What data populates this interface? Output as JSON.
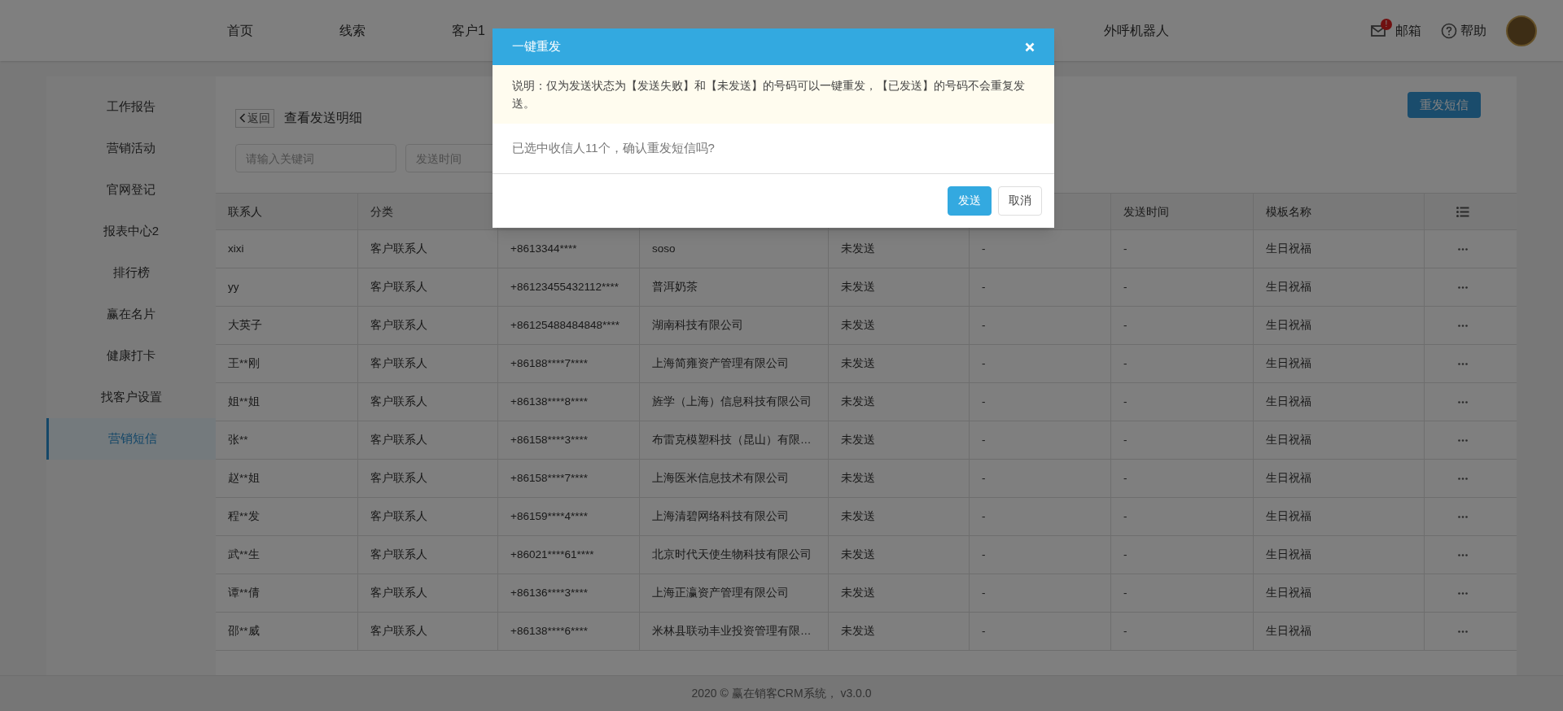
{
  "nav": {
    "items": [
      "首页",
      "线索",
      "客户1",
      "外呼机器人"
    ],
    "mail": {
      "label": "邮箱",
      "badge": "!"
    },
    "help": {
      "label": "帮助"
    }
  },
  "sidebar": {
    "items": [
      {
        "label": "工作报告",
        "selected": false
      },
      {
        "label": "营销活动",
        "selected": false
      },
      {
        "label": "官网登记",
        "selected": false
      },
      {
        "label": "报表中心2",
        "selected": false
      },
      {
        "label": "排行榜",
        "selected": false
      },
      {
        "label": "赢在名片",
        "selected": false
      },
      {
        "label": "健康打卡",
        "selected": false
      },
      {
        "label": "找客户设置",
        "selected": false
      },
      {
        "label": "营销短信",
        "selected": true
      }
    ]
  },
  "page": {
    "back": "返回",
    "title": "查看发送明细",
    "resend_button": "重发短信",
    "search": {
      "placeholder": "请输入关键词"
    },
    "time_filter": {
      "placeholder": "发送时间"
    }
  },
  "table": {
    "columns": {
      "column_1": "联系人",
      "column_2": "分类",
      "column_7": "发送时间",
      "column_8": "模板名称"
    },
    "rows": [
      [
        "xixi",
        "客户联系人",
        "+8613344****",
        "soso",
        "未发送",
        "-",
        "-",
        "生日祝福"
      ],
      [
        "yy",
        "客户联系人",
        "+86123455432112****",
        "普洱奶茶",
        "未发送",
        "-",
        "-",
        "生日祝福"
      ],
      [
        "大英子",
        "客户联系人",
        "+86125488484848****",
        "湖南科技有限公司",
        "未发送",
        "-",
        "-",
        "生日祝福"
      ],
      [
        "王**刚",
        "客户联系人",
        "+86188****7****",
        "上海简雍资产管理有限公司",
        "未发送",
        "-",
        "-",
        "生日祝福"
      ],
      [
        "姐**姐",
        "客户联系人",
        "+86138****8****",
        "旌学（上海）信息科技有限公司",
        "未发送",
        "-",
        "-",
        "生日祝福"
      ],
      [
        "张**",
        "客户联系人",
        "+86158****3****",
        "布雷克模塑科技（昆山）有限…",
        "未发送",
        "-",
        "-",
        "生日祝福"
      ],
      [
        "赵**姐",
        "客户联系人",
        "+86158****7****",
        "上海医米信息技术有限公司",
        "未发送",
        "-",
        "-",
        "生日祝福"
      ],
      [
        "程**发",
        "客户联系人",
        "+86159****4****",
        "上海清碧网络科技有限公司",
        "未发送",
        "-",
        "-",
        "生日祝福"
      ],
      [
        "武**生",
        "客户联系人",
        "+86021****61****",
        "北京时代天使生物科技有限公司",
        "未发送",
        "-",
        "-",
        "生日祝福"
      ],
      [
        "谭**倩",
        "客户联系人",
        "+86136****3****",
        "上海正瀛资产管理有限公司",
        "未发送",
        "-",
        "-",
        "生日祝福"
      ],
      [
        "邵**威",
        "客户联系人",
        "+86138****6****",
        "米林县联动丰业投资管理有限…",
        "未发送",
        "-",
        "-",
        "生日祝福"
      ]
    ]
  },
  "footer": "2020 © 赢在销客CRM系统， v3.0.0",
  "modal": {
    "title": "一键重发",
    "notice": "说明：仅为发送状态为【发送失败】和【未发送】的号码可以一键重发，【已发送】的号码不会重复发送。",
    "message": "已选中收信人11个，确认重发短信吗?",
    "buttons": [
      {
        "label": "发送",
        "kind": "primary"
      },
      {
        "label": "取消",
        "kind": "default"
      }
    ]
  }
}
